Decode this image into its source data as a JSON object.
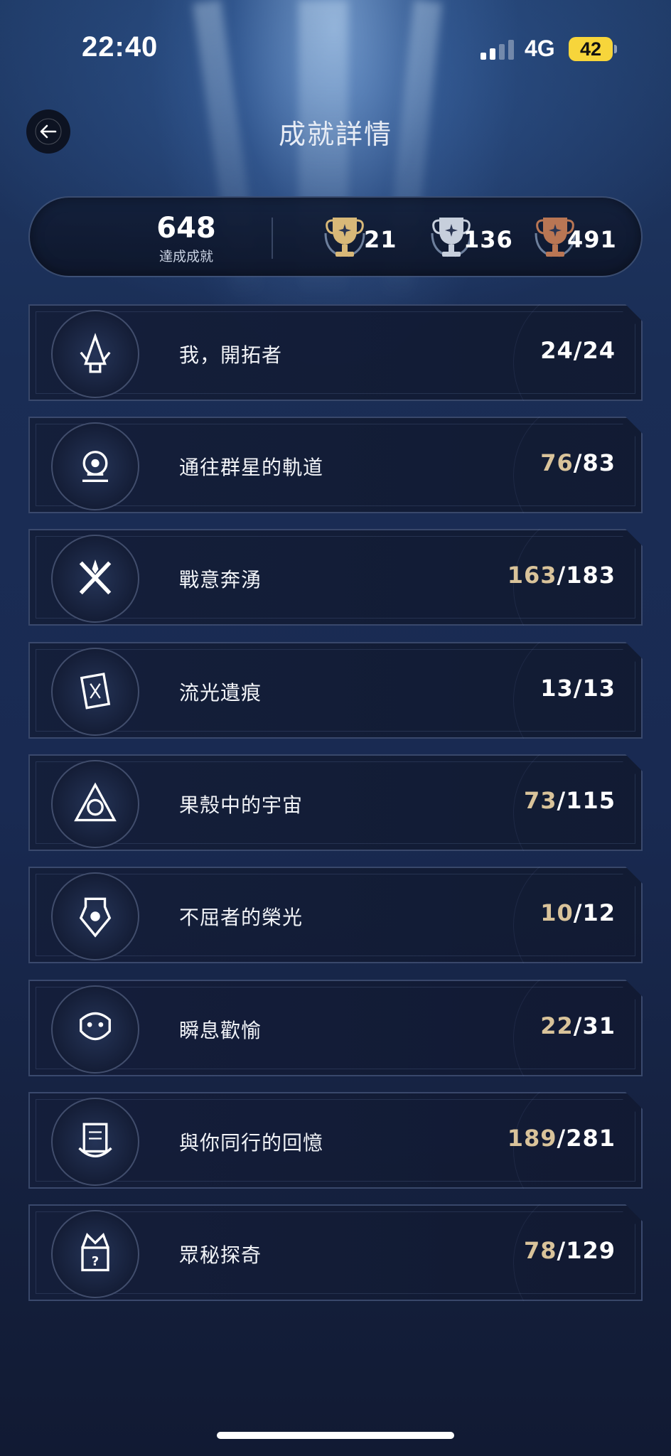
{
  "status_bar": {
    "time": "22:40",
    "network": "4G",
    "battery": "42"
  },
  "header": {
    "title": "成就詳情",
    "back_icon": "arrow-left-icon"
  },
  "summary": {
    "total": "648",
    "total_label": "達成成就",
    "trophies": [
      {
        "tier": "gold",
        "count": "21",
        "color": "#d8b878"
      },
      {
        "tier": "silver",
        "count": "136",
        "color": "#c7cfdc"
      },
      {
        "tier": "bronze",
        "count": "491",
        "color": "#b97654"
      }
    ]
  },
  "categories": [
    {
      "title": "我，開拓者",
      "done": "24",
      "total": "24",
      "complete": true
    },
    {
      "title": "通往群星的軌道",
      "done": "76",
      "total": "83",
      "complete": false
    },
    {
      "title": "戰意奔湧",
      "done": "163",
      "total": "183",
      "complete": false
    },
    {
      "title": "流光遺痕",
      "done": "13",
      "total": "13",
      "complete": true
    },
    {
      "title": "果殼中的宇宙",
      "done": "73",
      "total": "115",
      "complete": false
    },
    {
      "title": "不屈者的榮光",
      "done": "10",
      "total": "12",
      "complete": false
    },
    {
      "title": "瞬息歡愉",
      "done": "22",
      "total": "31",
      "complete": false
    },
    {
      "title": "與你同行的回憶",
      "done": "189",
      "total": "281",
      "complete": false
    },
    {
      "title": "眾秘探奇",
      "done": "78",
      "total": "129",
      "complete": false
    }
  ],
  "colors": {
    "accent_gold": "#d9c39a",
    "background": "#16213f"
  }
}
